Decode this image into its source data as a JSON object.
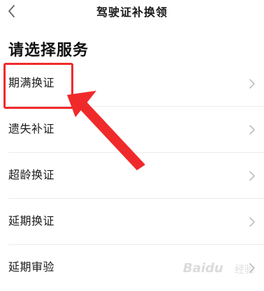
{
  "header": {
    "title": "驾驶证补换领",
    "back_icon": "chevron-left-icon"
  },
  "section": {
    "title": "请选择服务"
  },
  "services": [
    {
      "label": "期满换证"
    },
    {
      "label": "遗失补证"
    },
    {
      "label": "超龄换证"
    },
    {
      "label": "延期换证"
    },
    {
      "label": "延期审验"
    }
  ],
  "annotation": {
    "highlight_color": "#f02a2a"
  },
  "watermark": {
    "brand": "Baidu",
    "sub": "经验"
  }
}
